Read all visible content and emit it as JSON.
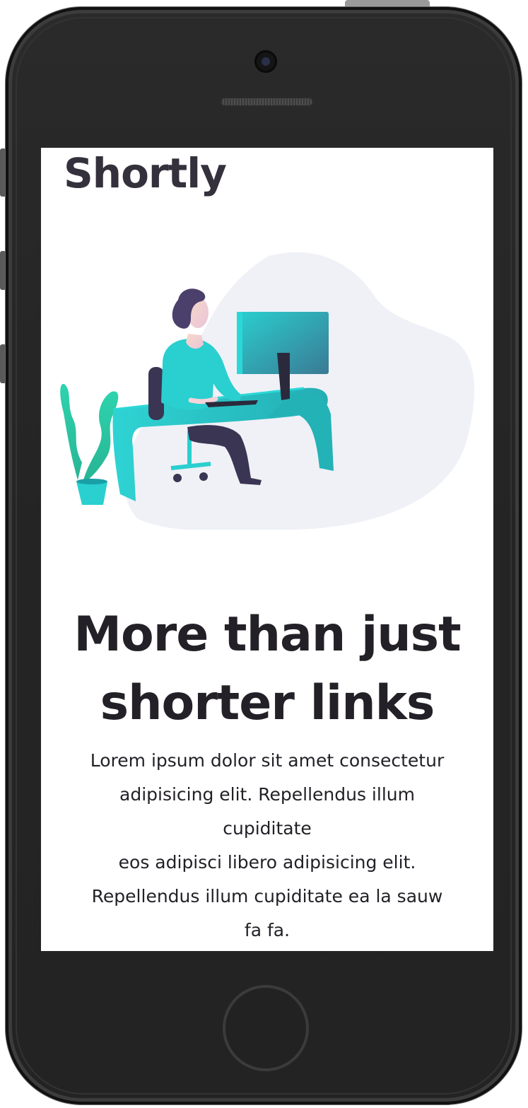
{
  "brand": {
    "logo": "Shortly"
  },
  "hero": {
    "headline_line1": "More than just",
    "headline_line2": "shorter links",
    "paragraph_lines": [
      "Lorem ipsum dolor sit amet consectetur",
      "adipisicing elit. Repellendus illum",
      "cupiditate",
      "eos adipisci libero adipisicing elit.",
      "Repellendus illum cupiditate ea la sauw",
      "fa fa."
    ]
  },
  "illustration": {
    "icon": "person-working-at-desk-illustration"
  },
  "colors": {
    "text_dark": "#232127",
    "logo": "#34313d",
    "accent_cyan": "#2acfcf",
    "blob": "#eff1f7",
    "hair": "#4b3f6b"
  }
}
